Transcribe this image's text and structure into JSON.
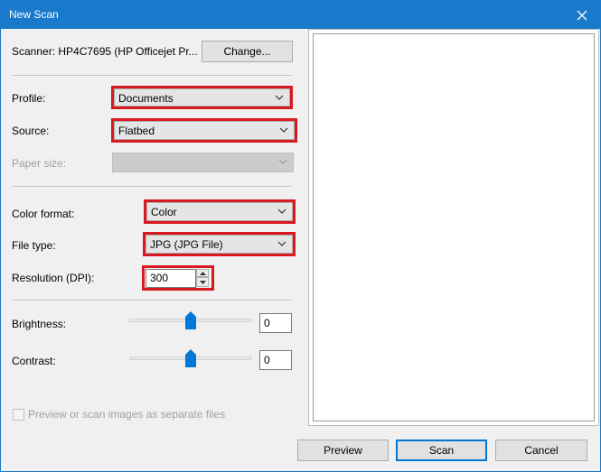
{
  "window": {
    "title": "New Scan"
  },
  "scanner": {
    "label": "Scanner: HP4C7695 (HP Officejet Pr...",
    "change_button": "Change..."
  },
  "profile": {
    "label": "Profile:",
    "value": "Documents"
  },
  "source": {
    "label": "Source:",
    "value": "Flatbed"
  },
  "paper_size": {
    "label": "Paper size:",
    "value": ""
  },
  "color_format": {
    "label": "Color format:",
    "value": "Color"
  },
  "file_type": {
    "label": "File type:",
    "value": "JPG (JPG File)"
  },
  "resolution": {
    "label": "Resolution (DPI):",
    "value": "300"
  },
  "brightness": {
    "label": "Brightness:",
    "value": "0",
    "level": 0.5
  },
  "contrast": {
    "label": "Contrast:",
    "value": "0",
    "level": 0.5
  },
  "separate_files": {
    "label": "Preview or scan images as separate files",
    "checked": false
  },
  "buttons": {
    "preview": "Preview",
    "scan": "Scan",
    "cancel": "Cancel"
  },
  "colors": {
    "titlebar": "#1979ca",
    "highlight": "#d71920",
    "slider_thumb": "#0078d7"
  }
}
